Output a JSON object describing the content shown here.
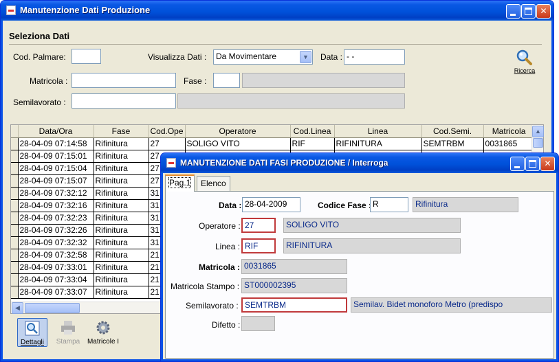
{
  "main_window": {
    "title": "Manutenzione Dati Produzione",
    "section_title": "Seleziona Dati",
    "cod_palmare_label": "Cod. Palmare:",
    "cod_palmare_value": "",
    "visualizza_label": "Visualizza Dati :",
    "visualizza_value": "Da Movimentare",
    "data_label": "Data :",
    "data_value": " -  - ",
    "matricola_label": "Matricola :",
    "matricola_value": "",
    "fase_label": "Fase :",
    "fase_value": "",
    "fase_desc": "",
    "semilavorato_label": "Semilavorato :",
    "semilavorato_value": "",
    "semilavorato_desc": "",
    "ricerca_label": "Ricerca",
    "toolbar": {
      "dettagli": "Dettagli",
      "stampa": "Stampa",
      "matricole": "Matricole I"
    }
  },
  "grid": {
    "columns": [
      "Data/Ora",
      "Fase",
      "Cod.Ope",
      "Operatore",
      "Cod.Linea",
      "Linea",
      "Cod.Semi.",
      "Matricola"
    ],
    "rows": [
      [
        "28-04-09 07:14:58",
        "Rifinitura",
        "27",
        "SOLIGO VITO",
        "RIF",
        "RIFINITURA",
        "SEMTRBM",
        "0031865"
      ],
      [
        "28-04-09 07:15:01",
        "Rifinitura",
        "27",
        "",
        "",
        "",
        "",
        ""
      ],
      [
        "28-04-09 07:15:04",
        "Rifinitura",
        "27",
        "",
        "",
        "",
        "",
        ""
      ],
      [
        "28-04-09 07:15:07",
        "Rifinitura",
        "27",
        "",
        "",
        "",
        "",
        ""
      ],
      [
        "28-04-09 07:32:12",
        "Rifinitura",
        "31",
        "",
        "",
        "",
        "",
        ""
      ],
      [
        "28-04-09 07:32:16",
        "Rifinitura",
        "31",
        "",
        "",
        "",
        "",
        ""
      ],
      [
        "28-04-09 07:32:23",
        "Rifinitura",
        "31",
        "",
        "",
        "",
        "",
        ""
      ],
      [
        "28-04-09 07:32:26",
        "Rifinitura",
        "31",
        "",
        "",
        "",
        "",
        ""
      ],
      [
        "28-04-09 07:32:32",
        "Rifinitura",
        "31",
        "",
        "",
        "",
        "",
        ""
      ],
      [
        "28-04-09 07:32:58",
        "Rifinitura",
        "21",
        "",
        "",
        "",
        "",
        ""
      ],
      [
        "28-04-09 07:33:01",
        "Rifinitura",
        "21",
        "",
        "",
        "",
        "",
        ""
      ],
      [
        "28-04-09 07:33:04",
        "Rifinitura",
        "21",
        "",
        "",
        "",
        "",
        ""
      ],
      [
        "28-04-09 07:33:07",
        "Rifinitura",
        "21",
        "",
        "",
        "",
        "",
        ""
      ]
    ]
  },
  "dialog": {
    "title": "MANUTENZIONE DATI FASI PRODUZIONE / Interroga",
    "tabs": [
      "Pag.1",
      "Elenco"
    ],
    "data_label": "Data :",
    "data_value": "28-04-2009",
    "codice_fase_label": "Codice Fase :",
    "codice_fase_value": "R",
    "fase_desc": "Rifinitura",
    "operatore_label": "Operatore :",
    "operatore_value": "27",
    "operatore_desc": "SOLIGO VITO",
    "linea_label": "Linea :",
    "linea_value": "RIF",
    "linea_desc": "RIFINITURA",
    "matricola_label": "Matricola :",
    "matricola_value": "0031865",
    "matricola_stampo_label": "Matricola Stampo :",
    "matricola_stampo_value": "ST000002395",
    "semilavorato_label": "Semilavorato :",
    "semilavorato_value": "SEMTRBM",
    "semilavorato_desc": "Semilav. Bidet monoforo Metro (predispo",
    "difetto_label": "Difetto :",
    "difetto_value": ""
  }
}
